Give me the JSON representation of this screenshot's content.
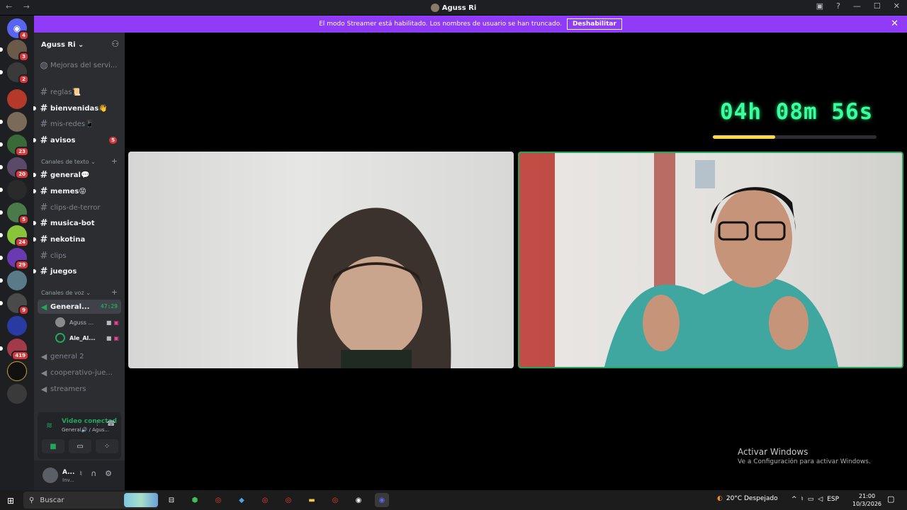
{
  "window": {
    "title": "Aguss Ri",
    "nav_arrows": "← →",
    "controls": [
      "▣",
      "?",
      "—",
      "☐",
      "✕"
    ]
  },
  "banner": {
    "text": "El modo Streamer está habilitado. Los nombres de usuario se han truncado.",
    "button": "Deshabilitar",
    "close": "✕"
  },
  "servers": [
    {
      "badge": "4"
    },
    {
      "badge": "3"
    },
    {
      "badge": "2"
    },
    {
      "badge": ""
    },
    {
      "badge": ""
    },
    {
      "badge": "23"
    },
    {
      "badge": "20"
    },
    {
      "badge": ""
    },
    {
      "badge": "5"
    },
    {
      "badge": "24"
    },
    {
      "badge": "29"
    },
    {
      "badge": ""
    },
    {
      "badge": "9"
    },
    {
      "badge": ""
    },
    {
      "badge": "419"
    },
    {
      "badge": ""
    },
    {
      "badge": ""
    }
  ],
  "guild": {
    "name": "Aguss Ri ⌄",
    "invite_icon": "person-add-icon"
  },
  "channels_top": [
    {
      "icon": "◍",
      "name": "Mejoras del servi...",
      "unread": false
    },
    {
      "icon": "#",
      "name": "reglas📜",
      "unread": false
    },
    {
      "icon": "#",
      "name": "bienvenidas👋",
      "unread": true
    },
    {
      "icon": "#",
      "name": "mis-redes📱",
      "unread": false
    },
    {
      "icon": "#",
      "name": "avisos",
      "unread": true,
      "count": "5"
    }
  ],
  "text_category": "Canales de texto ⌄",
  "text_channels": [
    {
      "name": "general💬",
      "unread": true
    },
    {
      "name": "memes😝",
      "unread": true
    },
    {
      "name": "clips-de-terror",
      "unread": false
    },
    {
      "name": "musica-bot",
      "unread": true
    },
    {
      "name": "nekotina",
      "unread": true
    },
    {
      "name": "clips",
      "unread": false
    },
    {
      "name": "juegos",
      "unread": true
    }
  ],
  "voice_category": "Canales de voz ⌄",
  "voice_active": {
    "name": "General...",
    "timer": "47:29"
  },
  "voice_users": [
    {
      "name": "Aguss ..."
    },
    {
      "name": "Ale_Al..."
    }
  ],
  "voice_channels": [
    {
      "name": "general 2"
    },
    {
      "name": "cooperativo-jue..."
    },
    {
      "name": "streamers"
    }
  ],
  "voice_panel": {
    "status": "Video conectad",
    "sub": "General🔊 / Agus..."
  },
  "user_panel": {
    "name": "A...",
    "status": "Inv..."
  },
  "stream": {
    "countdown": "04h 08m 56s",
    "progress": 0.38
  },
  "watermark": {
    "title": "Activar Windows",
    "subtitle": "Ve a Configuración para activar Windows."
  },
  "taskbar": {
    "search_placeholder": "Buscar",
    "weather": "20°C  Despejado",
    "lang": "ESP",
    "time": "21:00",
    "date": "10/3/2026"
  }
}
